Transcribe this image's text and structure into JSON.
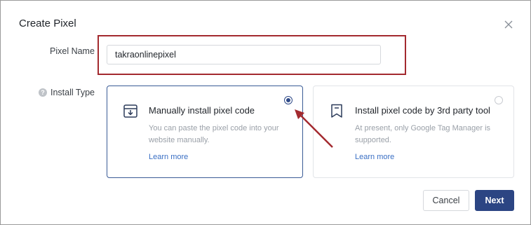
{
  "dialog": {
    "title": "Create Pixel",
    "close_icon": "close-icon"
  },
  "form": {
    "pixel_name_label": "Pixel Name",
    "pixel_name_value": "takraonlinepixel",
    "install_type_label": "Install Type",
    "help_icon": "help-icon"
  },
  "options": [
    {
      "icon": "download-box-icon",
      "title": "Manually install pixel code",
      "description": "You can paste the pixel code into your website manually.",
      "link": "Learn more",
      "selected": true
    },
    {
      "icon": "bookmark-icon",
      "title": "Install pixel code by 3rd party tool",
      "description": "At present, only Google Tag Manager is supported.",
      "link": "Learn more",
      "selected": false
    }
  ],
  "footer": {
    "cancel_label": "Cancel",
    "next_label": "Next"
  },
  "colors": {
    "primary": "#2c4583",
    "annotation_red": "#a32a2f",
    "link": "#3a6fc4"
  }
}
